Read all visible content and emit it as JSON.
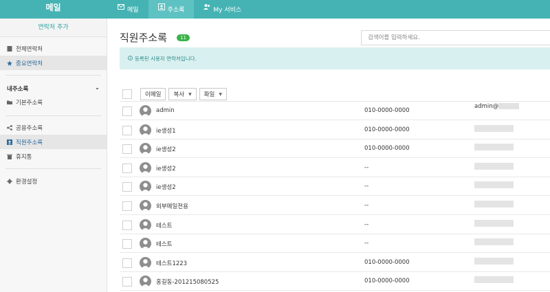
{
  "topbar": {
    "brand": "메일",
    "nav": [
      {
        "label": "메일",
        "icon": "mail-icon"
      },
      {
        "label": "주소록",
        "icon": "contact-card-icon"
      },
      {
        "label": "My 서비스",
        "icon": "users-icon"
      }
    ]
  },
  "sidebar": {
    "add_label": "연락처 추가",
    "all_contacts": "전체연락처",
    "important_contacts": "중요연락처",
    "my_addressbook": "내주소록",
    "default_addressbook": "기본주소록",
    "shared_addressbook": "공용주소록",
    "employee_addressbook": "직원주소록",
    "trash": "휴지통",
    "settings": "환경설정"
  },
  "main": {
    "title": "직원주소록",
    "count": "11",
    "search_placeholder": "검색어를 입력하세요.",
    "notice": "등록된 사용자 연락처입니다.",
    "toolbar": {
      "email": "이메일",
      "copy": "복사",
      "file": "파일"
    },
    "rows": [
      {
        "name": "admin",
        "phone": "010-0000-0000",
        "email": "admin@"
      },
      {
        "name": "ie생성1",
        "phone": "010-0000-0000",
        "email": ""
      },
      {
        "name": "ie생성2",
        "phone": "010-0000-0000",
        "email": ""
      },
      {
        "name": "ie생성2",
        "phone": "--",
        "email": ""
      },
      {
        "name": "ie생성2",
        "phone": "--",
        "email": ""
      },
      {
        "name": "외부메일전용",
        "phone": "--",
        "email": ""
      },
      {
        "name": "테스트",
        "phone": "--",
        "email": ""
      },
      {
        "name": "테스트",
        "phone": "--",
        "email": ""
      },
      {
        "name": "테스트1223",
        "phone": "010-0000-0000",
        "email": ""
      },
      {
        "name": "홍길동-201215080525",
        "phone": "010-0000-0000",
        "email": ""
      }
    ]
  },
  "colors": {
    "topbar": "#45b3b3",
    "active_nav": "#5fc2c2",
    "badge": "#3bb34a",
    "notice_bg": "#d9f0f0"
  }
}
